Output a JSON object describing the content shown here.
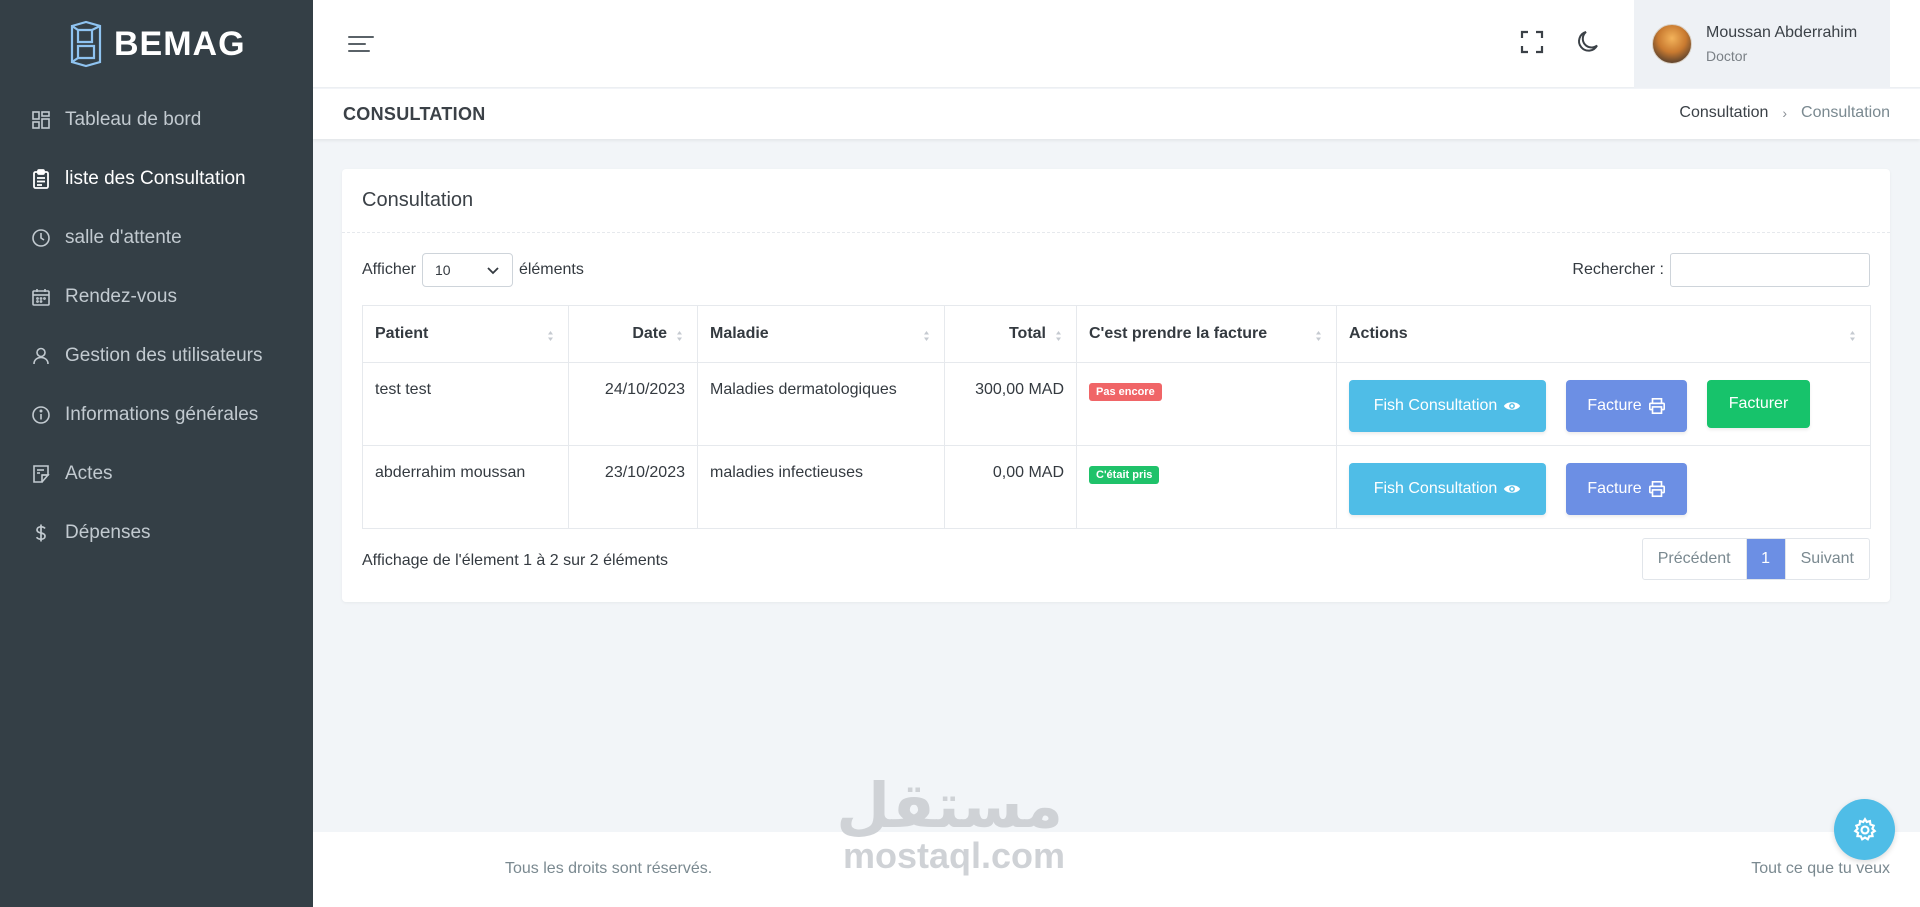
{
  "brand": {
    "name": "BEMAG"
  },
  "sidebar": {
    "items": [
      {
        "label": "Tableau de bord",
        "icon": "dashboard-icon",
        "active": false
      },
      {
        "label": "liste des Consultation",
        "icon": "clipboard-icon",
        "active": true
      },
      {
        "label": "salle d'attente",
        "icon": "clock-icon",
        "active": false
      },
      {
        "label": "Rendez-vous",
        "icon": "calendar-icon",
        "active": false
      },
      {
        "label": "Gestion des utilisateurs",
        "icon": "user-icon",
        "active": false
      },
      {
        "label": "Informations générales",
        "icon": "info-icon",
        "active": false
      },
      {
        "label": "Actes",
        "icon": "note-icon",
        "active": false
      },
      {
        "label": "Dépenses",
        "icon": "dollar-icon",
        "active": false
      }
    ]
  },
  "topbar": {
    "user": {
      "name": "Moussan Abderrahim",
      "role": "Doctor"
    }
  },
  "page": {
    "title": "CONSULTATION",
    "breadcrumb": {
      "link": "Consultation",
      "current": "Consultation"
    }
  },
  "card": {
    "title": "Consultation",
    "length": {
      "prefix": "Afficher",
      "value": "10",
      "suffix": "éléments"
    },
    "search": {
      "label": "Rechercher :"
    },
    "columns": [
      "Patient",
      "Date",
      "Maladie",
      "Total",
      "C'est prendre la facture",
      "Actions"
    ],
    "rows": [
      {
        "patient": "test test",
        "date": "24/10/2023",
        "maladie": "Maladies dermatologiques",
        "total": "300,00 MAD",
        "status": "Pas encore",
        "status_color": "#f06567"
      },
      {
        "patient": "abderrahim moussan",
        "date": "23/10/2023",
        "maladie": "maladies infectieuses",
        "total": "0,00 MAD",
        "status": "C'était pris",
        "status_color": "#1fc26a"
      }
    ],
    "buttons": {
      "fish": "Fish Consultation",
      "facture": "Facture",
      "facturer": "Facturer"
    },
    "info": "Affichage de l'élement 1 à 2 sur 2 éléments",
    "pagination": {
      "prev": "Précédent",
      "page": "1",
      "next": "Suivant"
    }
  },
  "footer": {
    "copyright": "Tous les droits sont réservés.",
    "tagline": "Tout ce que tu veux",
    "watermark_ar": "مستقل",
    "watermark_en": "mostaql.com"
  },
  "colors": {
    "sidebar_bg": "#343f46",
    "info": "#4fbde7",
    "primary": "#6c8fe4",
    "success": "#17c36b",
    "danger": "#f06567"
  }
}
